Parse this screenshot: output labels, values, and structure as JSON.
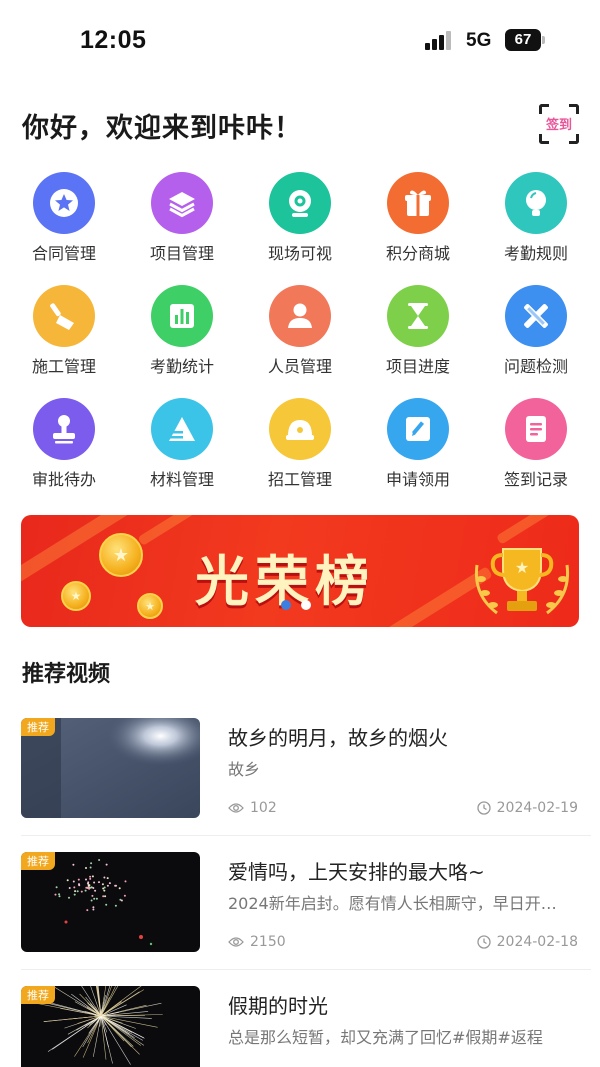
{
  "status_bar": {
    "time": "12:05",
    "network": "5G",
    "battery": "67"
  },
  "greeting": "你好，欢迎来到咔咔！",
  "sign_in_label": "签到",
  "grid": [
    {
      "label": "合同管理",
      "icon": "star-badge-icon",
      "color": "#5b73f5"
    },
    {
      "label": "项目管理",
      "icon": "layers-icon",
      "color": "#b460ec"
    },
    {
      "label": "现场可视",
      "icon": "camera-icon",
      "color": "#1cc39b"
    },
    {
      "label": "积分商城",
      "icon": "gift-icon",
      "color": "#f36c32"
    },
    {
      "label": "考勤规则",
      "icon": "lightbulb-icon",
      "color": "#2fc6bd"
    },
    {
      "label": "施工管理",
      "icon": "shovel-icon",
      "color": "#f6b63a"
    },
    {
      "label": "考勤统计",
      "icon": "bar-chart-icon",
      "color": "#3fcf67"
    },
    {
      "label": "人员管理",
      "icon": "person-icon",
      "color": "#f2785a"
    },
    {
      "label": "项目进度",
      "icon": "hourglass-icon",
      "color": "#7ed04a"
    },
    {
      "label": "问题检测",
      "icon": "tools-icon",
      "color": "#3d8ff0"
    },
    {
      "label": "审批待办",
      "icon": "stamp-icon",
      "color": "#7b5cec"
    },
    {
      "label": "材料管理",
      "icon": "materials-icon",
      "color": "#3cc3e8"
    },
    {
      "label": "招工管理",
      "icon": "helmet-icon",
      "color": "#f6c739"
    },
    {
      "label": "申请领用",
      "icon": "edit-icon",
      "color": "#36a6ef"
    },
    {
      "label": "签到记录",
      "icon": "notes-icon",
      "color": "#f2639c"
    }
  ],
  "banner": {
    "title": "光荣榜",
    "slides": 2,
    "active_slide": 0
  },
  "colors": {
    "banner_red": "#ee2a1a",
    "tag_orange": "#f2a81e",
    "dot_active": "#3d7fe0"
  },
  "section_title": "推荐视频",
  "videos": [
    {
      "tag": "推荐",
      "title": "故乡的明月，故乡的烟火",
      "desc": "故乡",
      "views": "102",
      "date": "2024-02-19",
      "thumb": "night-building"
    },
    {
      "tag": "推荐",
      "title": "爱情吗，上天安排的最大咯~",
      "desc": "2024新年启封。愿有情人长相厮守，早日开…",
      "views": "2150",
      "date": "2024-02-18",
      "thumb": "fireworks-small"
    },
    {
      "tag": "推荐",
      "title": "假期的时光",
      "desc": "总是那么短暂，却又充满了回忆#假期#返程",
      "views": "",
      "date": "",
      "thumb": "fireworks-large"
    }
  ]
}
